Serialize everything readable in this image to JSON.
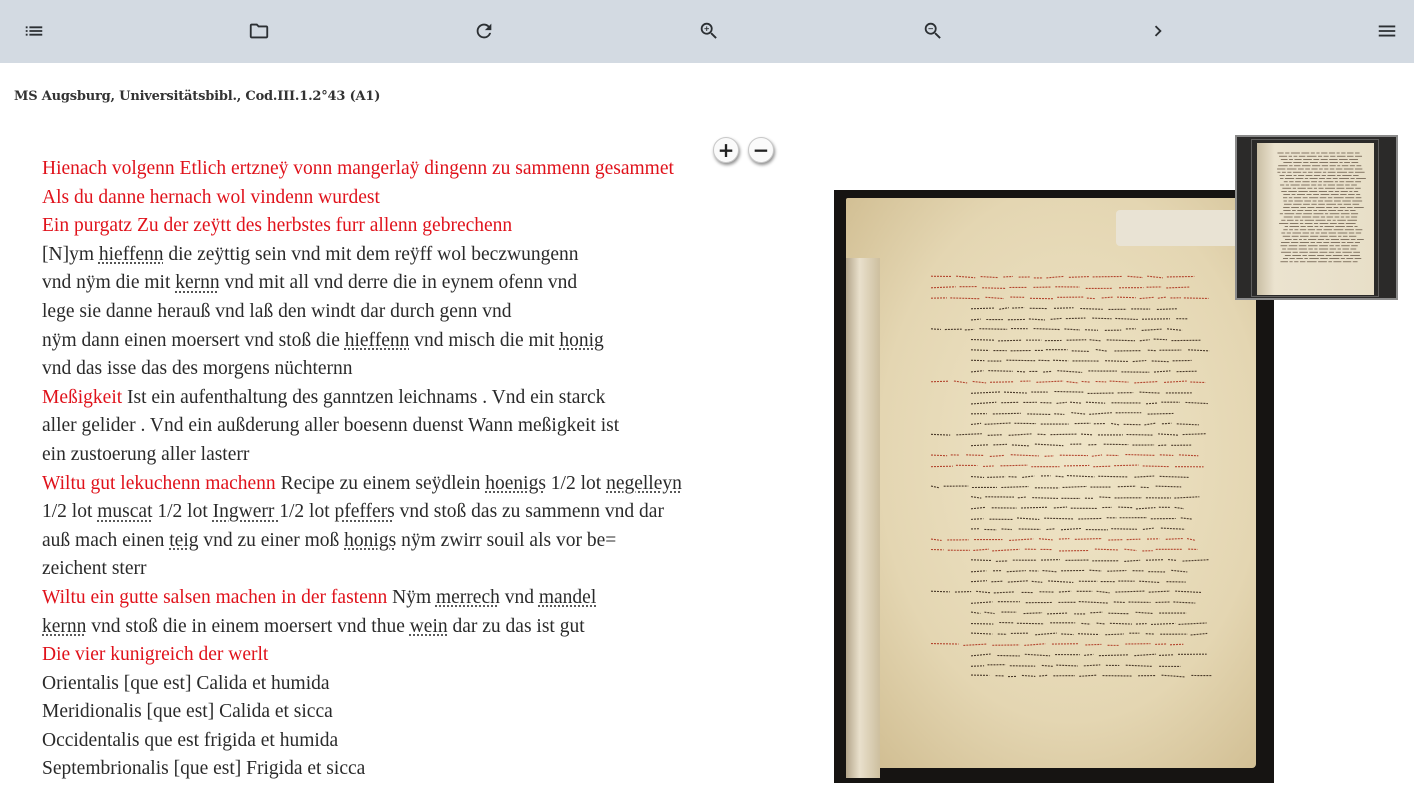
{
  "toolbar": {
    "buttons": [
      {
        "icon": "list-icon",
        "name": "toc-button"
      },
      {
        "icon": "folder-icon",
        "name": "open-button"
      },
      {
        "icon": "refresh-icon",
        "name": "reload-button"
      },
      {
        "icon": "zoom-in-icon",
        "name": "zoom-in-button"
      },
      {
        "icon": "zoom-out-icon",
        "name": "zoom-out-button"
      },
      {
        "icon": "chevron-right-icon",
        "name": "next-button"
      },
      {
        "icon": "menu-icon",
        "name": "menu-button"
      }
    ]
  },
  "manuscript": {
    "title": "MS Augsburg, Universitätsbibl., Cod.III.1.2°43 (A1)"
  },
  "text_lines": [
    [
      {
        "t": "Hienach volgenn Etlich ertzneÿ vonn mangerlaÿ dingenn zu sammenn gesammet",
        "red": true
      }
    ],
    [
      {
        "t": "Als du danne hernach wol vindenn wurdest",
        "red": true
      }
    ],
    [
      {
        "t": "Ein purgatz Zu der zeÿtt des herbstes furr allenn gebrechenn",
        "red": true
      }
    ],
    [
      {
        "t": "[N]ym "
      },
      {
        "t": "hieffenn",
        "abbr": true
      },
      {
        "t": " die zeÿttig sein vnd mit dem reÿff wol beczwungenn"
      }
    ],
    [
      {
        "t": "vnd nÿm die mit "
      },
      {
        "t": "kernn",
        "abbr": true
      },
      {
        "t": " vnd mit all vnd derre die in eynem ofenn vnd"
      }
    ],
    [
      {
        "t": "lege sie danne herauß vnd laß den windt dar durch genn vnd"
      }
    ],
    [
      {
        "t": "nÿm dann einen moersert vnd stoß die "
      },
      {
        "t": "hieffenn",
        "abbr": true
      },
      {
        "t": " vnd misch die mit "
      },
      {
        "t": "honig",
        "abbr": true
      }
    ],
    [
      {
        "t": "vnd das isse das des morgens nüchternn"
      }
    ],
    [
      {
        "t": "Meßigkeit",
        "red": true
      },
      {
        "t": " Ist ein aufenthaltung des ganntzen leichnams . Vnd ein starck"
      }
    ],
    [
      {
        "t": "aller gelider . Vnd ein außderung aller boesenn duenst Wann meßigkeit ist"
      }
    ],
    [
      {
        "t": "ein zustoerung aller lasterr"
      }
    ],
    [
      {
        "t": "Wiltu gut lekuchenn machenn",
        "red": true
      },
      {
        "t": " Recipe zu einem seÿdlein "
      },
      {
        "t": "hoenigs",
        "abbr": true
      },
      {
        "t": " 1/2 lot "
      },
      {
        "t": "negelleyn",
        "abbr": true
      }
    ],
    [
      {
        "t": "1/2 lot "
      },
      {
        "t": "muscat",
        "abbr": true
      },
      {
        "t": " 1/2 lot "
      },
      {
        "t": "Ingwerr ",
        "abbr": true
      },
      {
        "t": "1/2 lot "
      },
      {
        "t": "pfeffers",
        "abbr": true
      },
      {
        "t": " vnd stoß das zu sammenn vnd dar"
      }
    ],
    [
      {
        "t": "auß mach einen "
      },
      {
        "t": "teig",
        "abbr": true
      },
      {
        "t": " vnd zu einer moß "
      },
      {
        "t": "honigs",
        "abbr": true
      },
      {
        "t": " nÿm zwirr souil als vor be="
      }
    ],
    [
      {
        "t": "zeichent sterr"
      }
    ],
    [
      {
        "t": "Wiltu ein gutte salsen machen in der fastenn",
        "red": true
      },
      {
        "t": " Nÿm "
      },
      {
        "t": "merrech",
        "abbr": true
      },
      {
        "t": " vnd "
      },
      {
        "t": "mandel",
        "abbr": true
      }
    ],
    [
      {
        "t": "kernn",
        "abbr": true
      },
      {
        "t": " vnd stoß die in einem moersert vnd thue "
      },
      {
        "t": "wein",
        "abbr": true
      },
      {
        "t": " dar zu das ist gut"
      }
    ],
    [
      {
        "t": "Die vier kunigreich der werlt",
        "red": true
      }
    ],
    [
      {
        "t": "Orientalis [que est] Calida et humida"
      }
    ],
    [
      {
        "t": "Meridionalis [que est] Calida et sicca"
      }
    ],
    [
      {
        "t": "Occidentalis que est frigida et humida"
      }
    ],
    [
      {
        "t": "Septembrionalis [que est] Frigida et sicca"
      }
    ]
  ],
  "zoom_controls": {
    "plus": "+",
    "minus": "−"
  },
  "colors": {
    "rubric": "#e0121b",
    "toolbar": "#d3dae2"
  }
}
